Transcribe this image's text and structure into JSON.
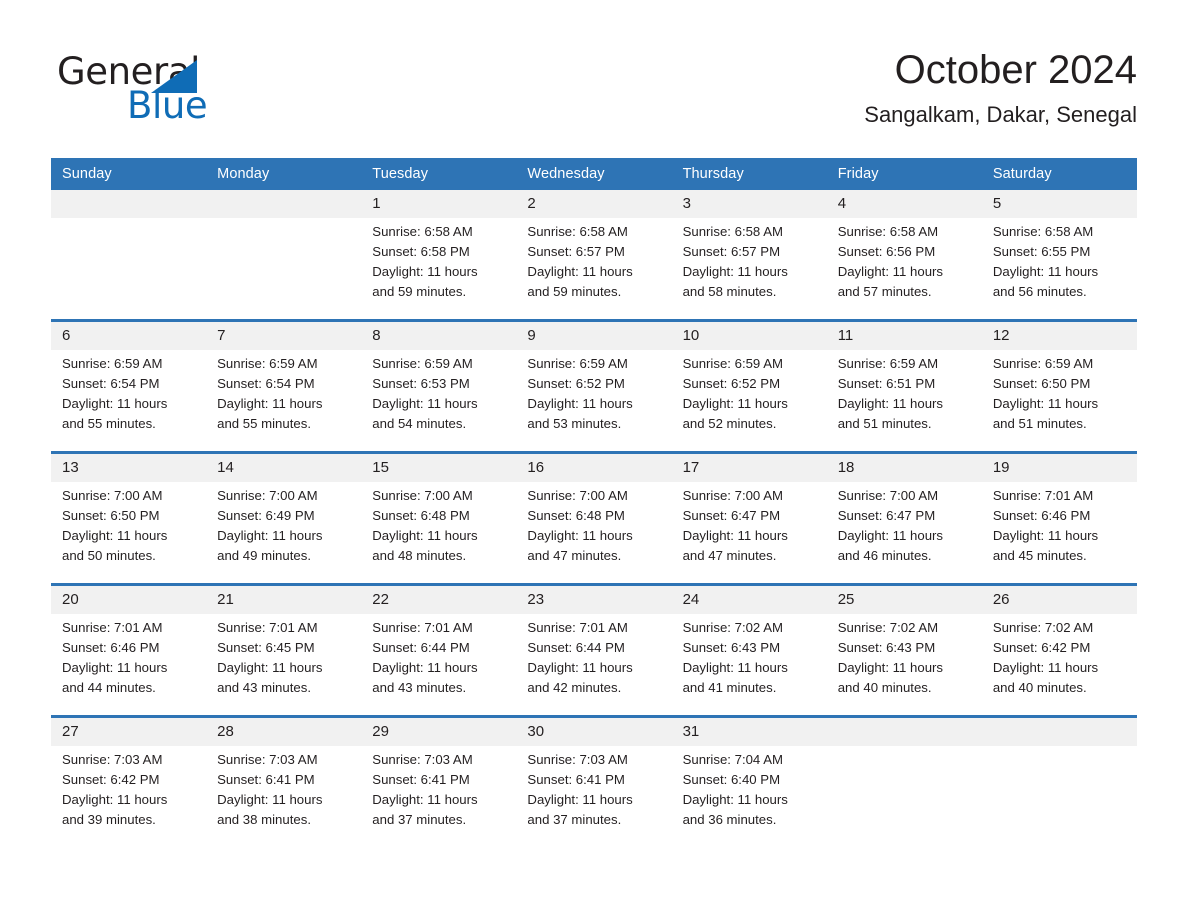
{
  "brand": {
    "name_part1": "General",
    "name_part2": "Blue",
    "accent_color": "#0f6cb6",
    "triangle_icon": "brand-triangle-icon"
  },
  "header": {
    "title": "October 2024",
    "subtitle": "Sangalkam, Dakar, Senegal",
    "header_bg_color": "#2e74b5",
    "daynum_bg_color": "#f1f1f1"
  },
  "weekdays": [
    "Sunday",
    "Monday",
    "Tuesday",
    "Wednesday",
    "Thursday",
    "Friday",
    "Saturday"
  ],
  "weeks": [
    [
      {
        "day": "",
        "sunrise": "",
        "sunset": "",
        "daylight1": "",
        "daylight2": ""
      },
      {
        "day": "",
        "sunrise": "",
        "sunset": "",
        "daylight1": "",
        "daylight2": ""
      },
      {
        "day": "1",
        "sunrise": "Sunrise: 6:58 AM",
        "sunset": "Sunset: 6:58 PM",
        "daylight1": "Daylight: 11 hours",
        "daylight2": "and 59 minutes."
      },
      {
        "day": "2",
        "sunrise": "Sunrise: 6:58 AM",
        "sunset": "Sunset: 6:57 PM",
        "daylight1": "Daylight: 11 hours",
        "daylight2": "and 59 minutes."
      },
      {
        "day": "3",
        "sunrise": "Sunrise: 6:58 AM",
        "sunset": "Sunset: 6:57 PM",
        "daylight1": "Daylight: 11 hours",
        "daylight2": "and 58 minutes."
      },
      {
        "day": "4",
        "sunrise": "Sunrise: 6:58 AM",
        "sunset": "Sunset: 6:56 PM",
        "daylight1": "Daylight: 11 hours",
        "daylight2": "and 57 minutes."
      },
      {
        "day": "5",
        "sunrise": "Sunrise: 6:58 AM",
        "sunset": "Sunset: 6:55 PM",
        "daylight1": "Daylight: 11 hours",
        "daylight2": "and 56 minutes."
      }
    ],
    [
      {
        "day": "6",
        "sunrise": "Sunrise: 6:59 AM",
        "sunset": "Sunset: 6:54 PM",
        "daylight1": "Daylight: 11 hours",
        "daylight2": "and 55 minutes."
      },
      {
        "day": "7",
        "sunrise": "Sunrise: 6:59 AM",
        "sunset": "Sunset: 6:54 PM",
        "daylight1": "Daylight: 11 hours",
        "daylight2": "and 55 minutes."
      },
      {
        "day": "8",
        "sunrise": "Sunrise: 6:59 AM",
        "sunset": "Sunset: 6:53 PM",
        "daylight1": "Daylight: 11 hours",
        "daylight2": "and 54 minutes."
      },
      {
        "day": "9",
        "sunrise": "Sunrise: 6:59 AM",
        "sunset": "Sunset: 6:52 PM",
        "daylight1": "Daylight: 11 hours",
        "daylight2": "and 53 minutes."
      },
      {
        "day": "10",
        "sunrise": "Sunrise: 6:59 AM",
        "sunset": "Sunset: 6:52 PM",
        "daylight1": "Daylight: 11 hours",
        "daylight2": "and 52 minutes."
      },
      {
        "day": "11",
        "sunrise": "Sunrise: 6:59 AM",
        "sunset": "Sunset: 6:51 PM",
        "daylight1": "Daylight: 11 hours",
        "daylight2": "and 51 minutes."
      },
      {
        "day": "12",
        "sunrise": "Sunrise: 6:59 AM",
        "sunset": "Sunset: 6:50 PM",
        "daylight1": "Daylight: 11 hours",
        "daylight2": "and 51 minutes."
      }
    ],
    [
      {
        "day": "13",
        "sunrise": "Sunrise: 7:00 AM",
        "sunset": "Sunset: 6:50 PM",
        "daylight1": "Daylight: 11 hours",
        "daylight2": "and 50 minutes."
      },
      {
        "day": "14",
        "sunrise": "Sunrise: 7:00 AM",
        "sunset": "Sunset: 6:49 PM",
        "daylight1": "Daylight: 11 hours",
        "daylight2": "and 49 minutes."
      },
      {
        "day": "15",
        "sunrise": "Sunrise: 7:00 AM",
        "sunset": "Sunset: 6:48 PM",
        "daylight1": "Daylight: 11 hours",
        "daylight2": "and 48 minutes."
      },
      {
        "day": "16",
        "sunrise": "Sunrise: 7:00 AM",
        "sunset": "Sunset: 6:48 PM",
        "daylight1": "Daylight: 11 hours",
        "daylight2": "and 47 minutes."
      },
      {
        "day": "17",
        "sunrise": "Sunrise: 7:00 AM",
        "sunset": "Sunset: 6:47 PM",
        "daylight1": "Daylight: 11 hours",
        "daylight2": "and 47 minutes."
      },
      {
        "day": "18",
        "sunrise": "Sunrise: 7:00 AM",
        "sunset": "Sunset: 6:47 PM",
        "daylight1": "Daylight: 11 hours",
        "daylight2": "and 46 minutes."
      },
      {
        "day": "19",
        "sunrise": "Sunrise: 7:01 AM",
        "sunset": "Sunset: 6:46 PM",
        "daylight1": "Daylight: 11 hours",
        "daylight2": "and 45 minutes."
      }
    ],
    [
      {
        "day": "20",
        "sunrise": "Sunrise: 7:01 AM",
        "sunset": "Sunset: 6:46 PM",
        "daylight1": "Daylight: 11 hours",
        "daylight2": "and 44 minutes."
      },
      {
        "day": "21",
        "sunrise": "Sunrise: 7:01 AM",
        "sunset": "Sunset: 6:45 PM",
        "daylight1": "Daylight: 11 hours",
        "daylight2": "and 43 minutes."
      },
      {
        "day": "22",
        "sunrise": "Sunrise: 7:01 AM",
        "sunset": "Sunset: 6:44 PM",
        "daylight1": "Daylight: 11 hours",
        "daylight2": "and 43 minutes."
      },
      {
        "day": "23",
        "sunrise": "Sunrise: 7:01 AM",
        "sunset": "Sunset: 6:44 PM",
        "daylight1": "Daylight: 11 hours",
        "daylight2": "and 42 minutes."
      },
      {
        "day": "24",
        "sunrise": "Sunrise: 7:02 AM",
        "sunset": "Sunset: 6:43 PM",
        "daylight1": "Daylight: 11 hours",
        "daylight2": "and 41 minutes."
      },
      {
        "day": "25",
        "sunrise": "Sunrise: 7:02 AM",
        "sunset": "Sunset: 6:43 PM",
        "daylight1": "Daylight: 11 hours",
        "daylight2": "and 40 minutes."
      },
      {
        "day": "26",
        "sunrise": "Sunrise: 7:02 AM",
        "sunset": "Sunset: 6:42 PM",
        "daylight1": "Daylight: 11 hours",
        "daylight2": "and 40 minutes."
      }
    ],
    [
      {
        "day": "27",
        "sunrise": "Sunrise: 7:03 AM",
        "sunset": "Sunset: 6:42 PM",
        "daylight1": "Daylight: 11 hours",
        "daylight2": "and 39 minutes."
      },
      {
        "day": "28",
        "sunrise": "Sunrise: 7:03 AM",
        "sunset": "Sunset: 6:41 PM",
        "daylight1": "Daylight: 11 hours",
        "daylight2": "and 38 minutes."
      },
      {
        "day": "29",
        "sunrise": "Sunrise: 7:03 AM",
        "sunset": "Sunset: 6:41 PM",
        "daylight1": "Daylight: 11 hours",
        "daylight2": "and 37 minutes."
      },
      {
        "day": "30",
        "sunrise": "Sunrise: 7:03 AM",
        "sunset": "Sunset: 6:41 PM",
        "daylight1": "Daylight: 11 hours",
        "daylight2": "and 37 minutes."
      },
      {
        "day": "31",
        "sunrise": "Sunrise: 7:04 AM",
        "sunset": "Sunset: 6:40 PM",
        "daylight1": "Daylight: 11 hours",
        "daylight2": "and 36 minutes."
      },
      {
        "day": "",
        "sunrise": "",
        "sunset": "",
        "daylight1": "",
        "daylight2": ""
      },
      {
        "day": "",
        "sunrise": "",
        "sunset": "",
        "daylight1": "",
        "daylight2": ""
      }
    ]
  ]
}
